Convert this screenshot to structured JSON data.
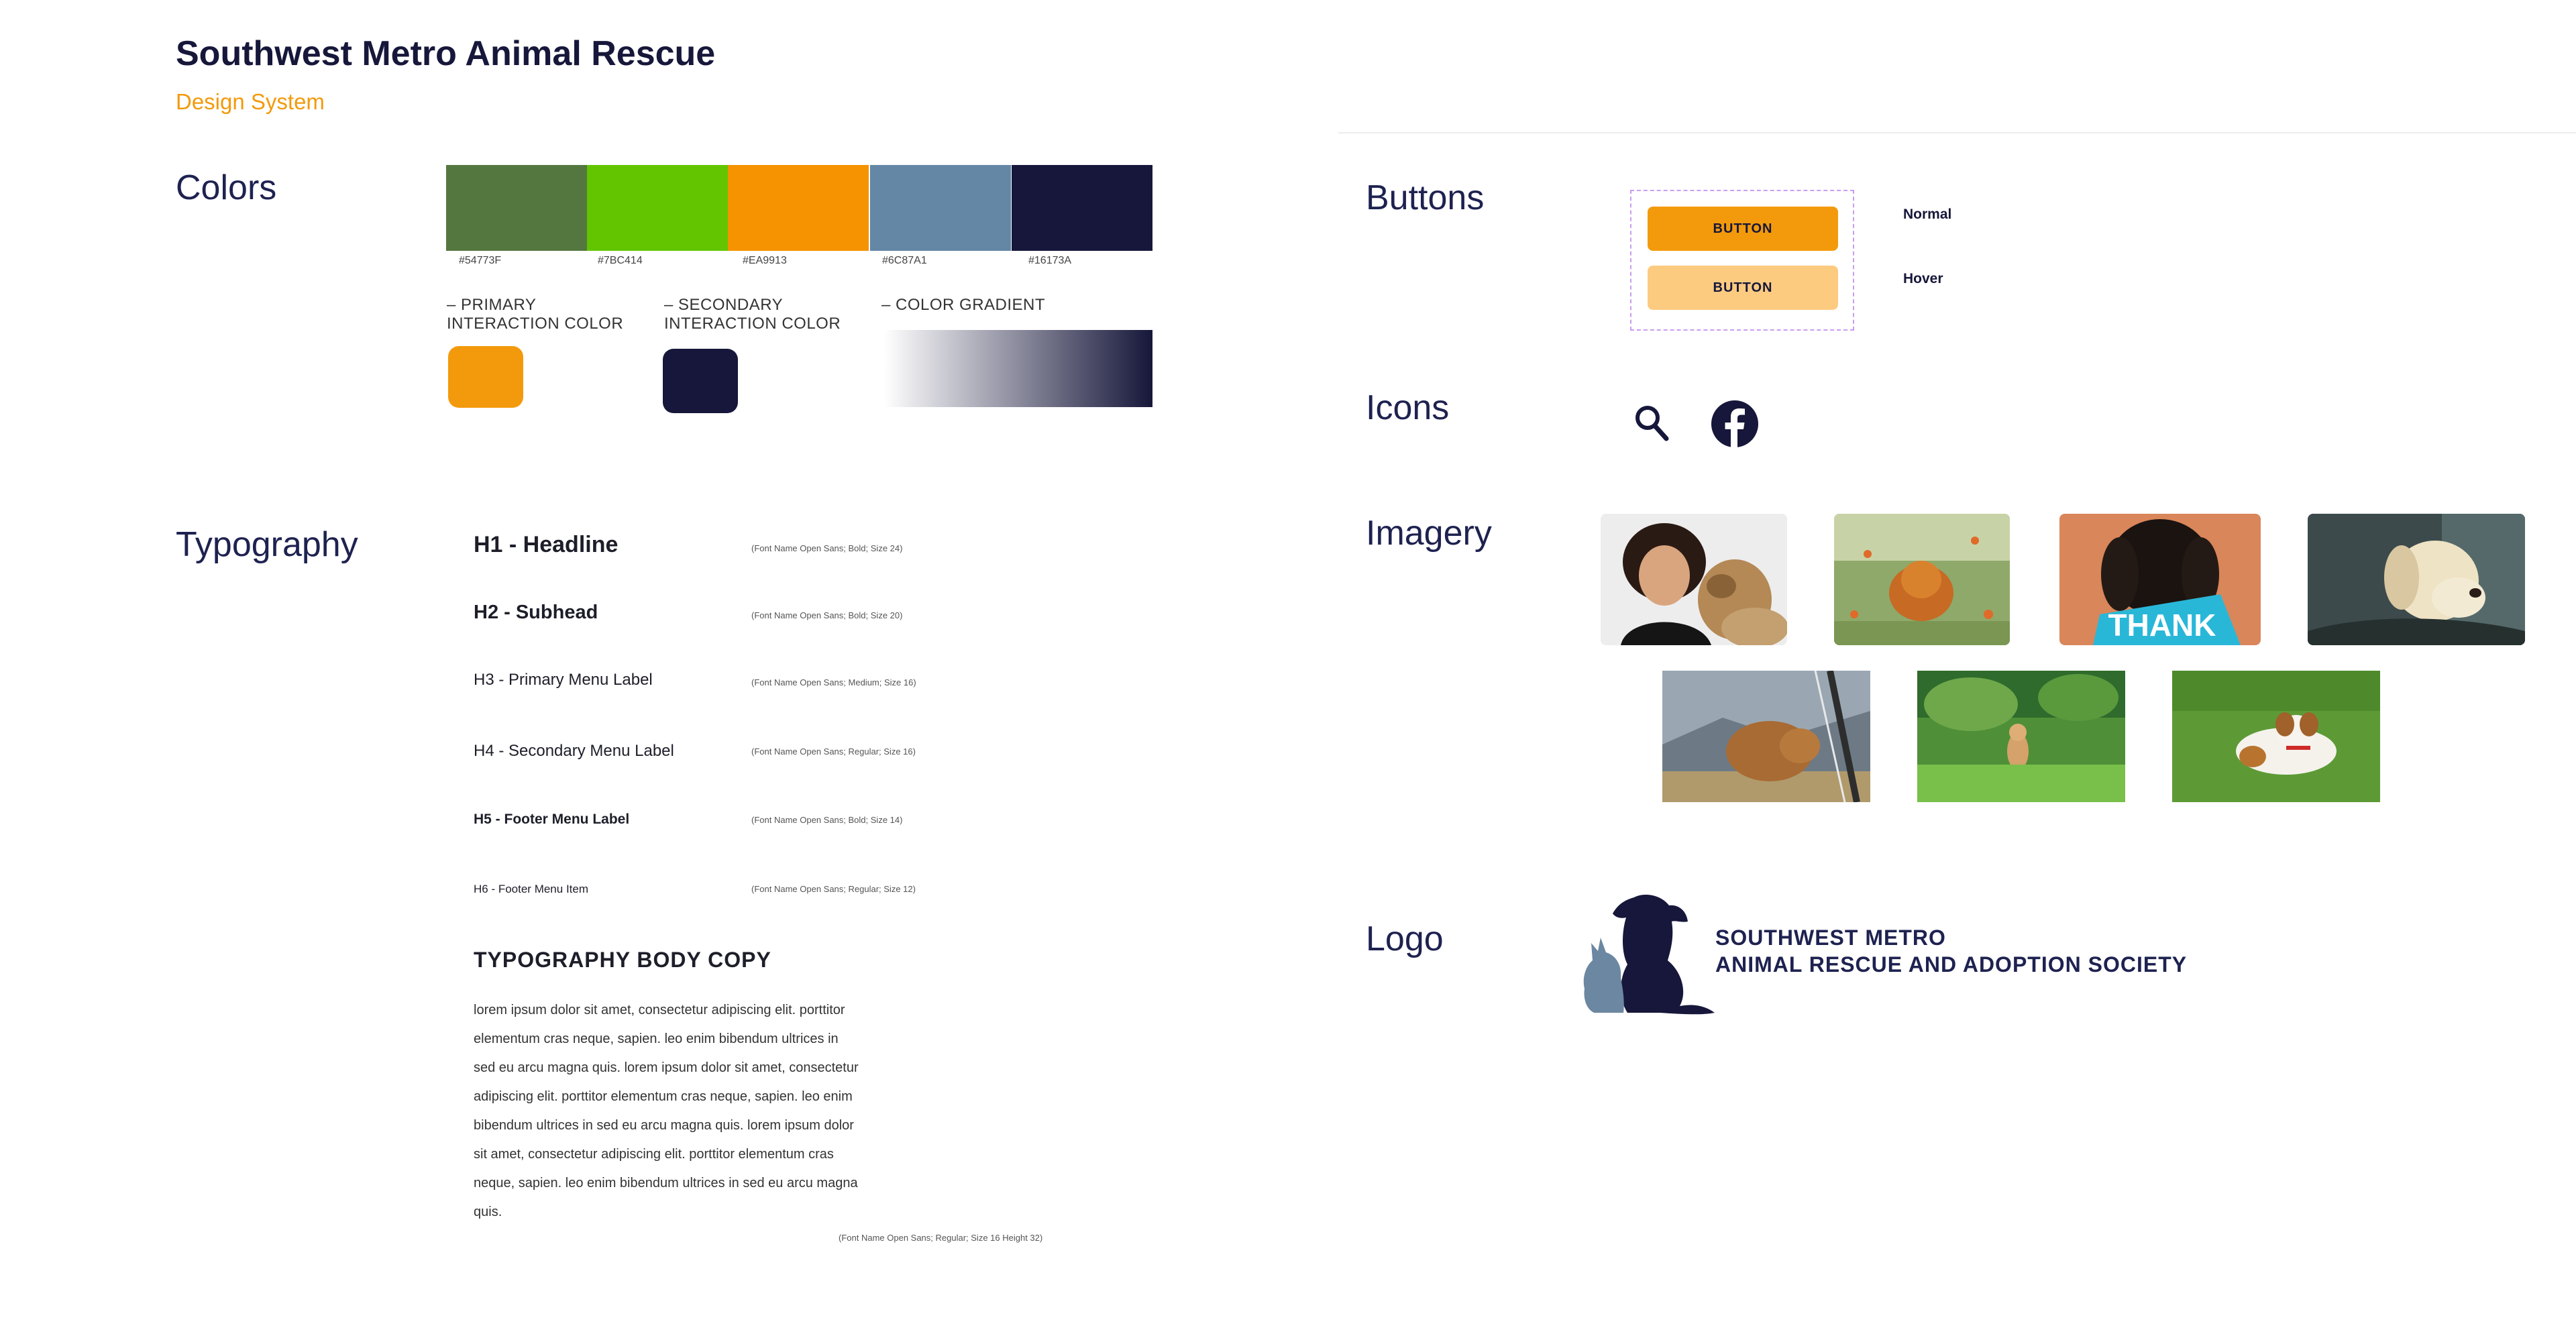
{
  "header": {
    "title": "Southwest Metro Animal Rescue",
    "subtitle": "Design System"
  },
  "colors": {
    "section_title": "Colors",
    "swatches": [
      {
        "hex": "#54773F",
        "label": "#54773F"
      },
      {
        "hex": "#7BC414",
        "label": "#7BC414"
      },
      {
        "hex": "#EA9913",
        "label": "#EA9913"
      },
      {
        "hex": "#6C87A1",
        "label": "#6C87A1"
      },
      {
        "hex": "#16173A",
        "label": "#16173A"
      }
    ],
    "primary_label": "– PRIMARY\nINTERACTION COLOR",
    "secondary_label": "– SECONDARY\nINTERACTION COLOR",
    "gradient_label": "– COLOR GRADIENT",
    "primary_hex": "#F39A0C",
    "secondary_hex": "#16173A"
  },
  "typography": {
    "section_title": "Typography",
    "styles": [
      {
        "label": "H1 - Headline",
        "note": "(Font Name Open Sans; Bold; Size 24)"
      },
      {
        "label": "H2 - Subhead",
        "note": "(Font Name Open Sans; Bold; Size 20)"
      },
      {
        "label": "H3 - Primary Menu Label",
        "note": "(Font Name Open Sans; Medium; Size 16)"
      },
      {
        "label": "H4 - Secondary Menu Label",
        "note": "(Font Name Open Sans; Regular; Size 16)"
      },
      {
        "label": "H5 - Footer Menu Label",
        "note": "(Font Name Open Sans; Bold; Size 14)"
      },
      {
        "label": "H6 - Footer Menu Item",
        "note": "(Font Name Open Sans; Regular; Size 12)"
      }
    ],
    "body_title": "TYPOGRAPHY BODY COPY",
    "body_copy": "lorem ipsum dolor sit amet, consectetur adipiscing elit. porttitor elementum cras neque, sapien. leo enim bibendum ultrices in sed eu arcu magna quis. lorem ipsum dolor sit amet, consectetur adipiscing elit. porttitor elementum cras neque, sapien. leo enim bibendum ultrices in sed eu arcu magna quis. lorem ipsum dolor sit amet, consectetur adipiscing elit. porttitor elementum cras neque, sapien. leo enim bibendum ultrices in sed eu arcu magna quis.",
    "body_note": "(Font Name Open Sans; Regular; Size 16 Height 32)"
  },
  "buttons": {
    "section_title": "Buttons",
    "normal_label": "BUTTON",
    "hover_label": "BUTTON",
    "normal_state": "Normal",
    "hover_state": "Hover"
  },
  "icons": {
    "section_title": "Icons",
    "items": [
      "search-icon",
      "facebook-icon"
    ]
  },
  "imagery": {
    "section_title": "Imagery",
    "photo_3_text": "THANK"
  },
  "logo": {
    "section_title": "Logo",
    "line1": "SOUTHWEST METRO",
    "line2": "ANIMAL RESCUE AND ADOPTION SOCIETY"
  }
}
